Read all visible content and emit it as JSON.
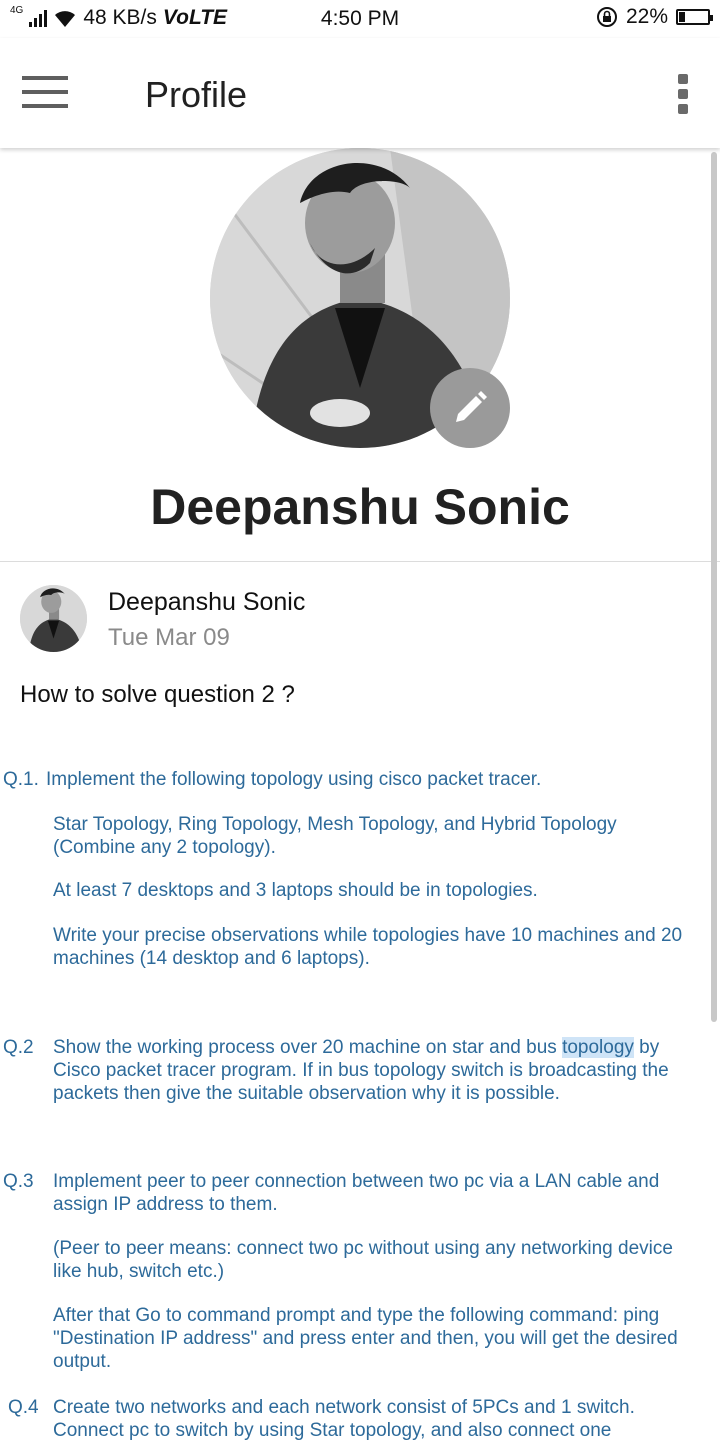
{
  "status_bar": {
    "network": "4G",
    "speed": "48 KB/s",
    "volte": "VoLTE",
    "time": "4:50 PM",
    "battery": "22%",
    "battery_level": 0.22
  },
  "app_bar": {
    "title": "Profile"
  },
  "profile": {
    "name": "Deepanshu Sonic"
  },
  "post": {
    "author": "Deepanshu Sonic",
    "date": "Tue Mar 09",
    "text": "How to solve question 2 ?"
  },
  "attachment": {
    "q1": {
      "num": "Q.1.",
      "title": "Implement the following topology using cisco packet tracer.",
      "para1": "Star Topology, Ring Topology, Mesh Topology, and Hybrid Topology (Combine any 2 topology).",
      "para2": "At least 7 desktops and 3 laptops should be in topologies.",
      "para3": "Write your precise observations while topologies have 10 machines and 20 machines (14 desktop and 6 laptops)."
    },
    "q2": {
      "num": "Q.2",
      "text_before": "Show the working process over 20 machine on star and bus ",
      "highlight": "topology",
      "text_after": " by Cisco packet tracer program. If in bus topology switch is broadcasting the packets then give the suitable observation why it is possible."
    },
    "q3": {
      "num": "Q.3",
      "para1": "Implement peer to peer connection between two pc via a LAN cable and assign IP address to them.",
      "para2": "(Peer to peer means: connect two pc without using any networking device like hub, switch etc.)",
      "para3": "After that Go to command prompt and type the following command: ping \"Destination IP address\" and press enter and then, you will get the desired output."
    },
    "q4": {
      "num": "Q.4",
      "para1": "Create two networks and each network consist of 5PCs and 1 switch. Connect pc to switch by using Star topology, and also connect one"
    }
  },
  "colors": {
    "attachment_text": "#2d6a9a",
    "highlight": "#cfe4f7"
  }
}
